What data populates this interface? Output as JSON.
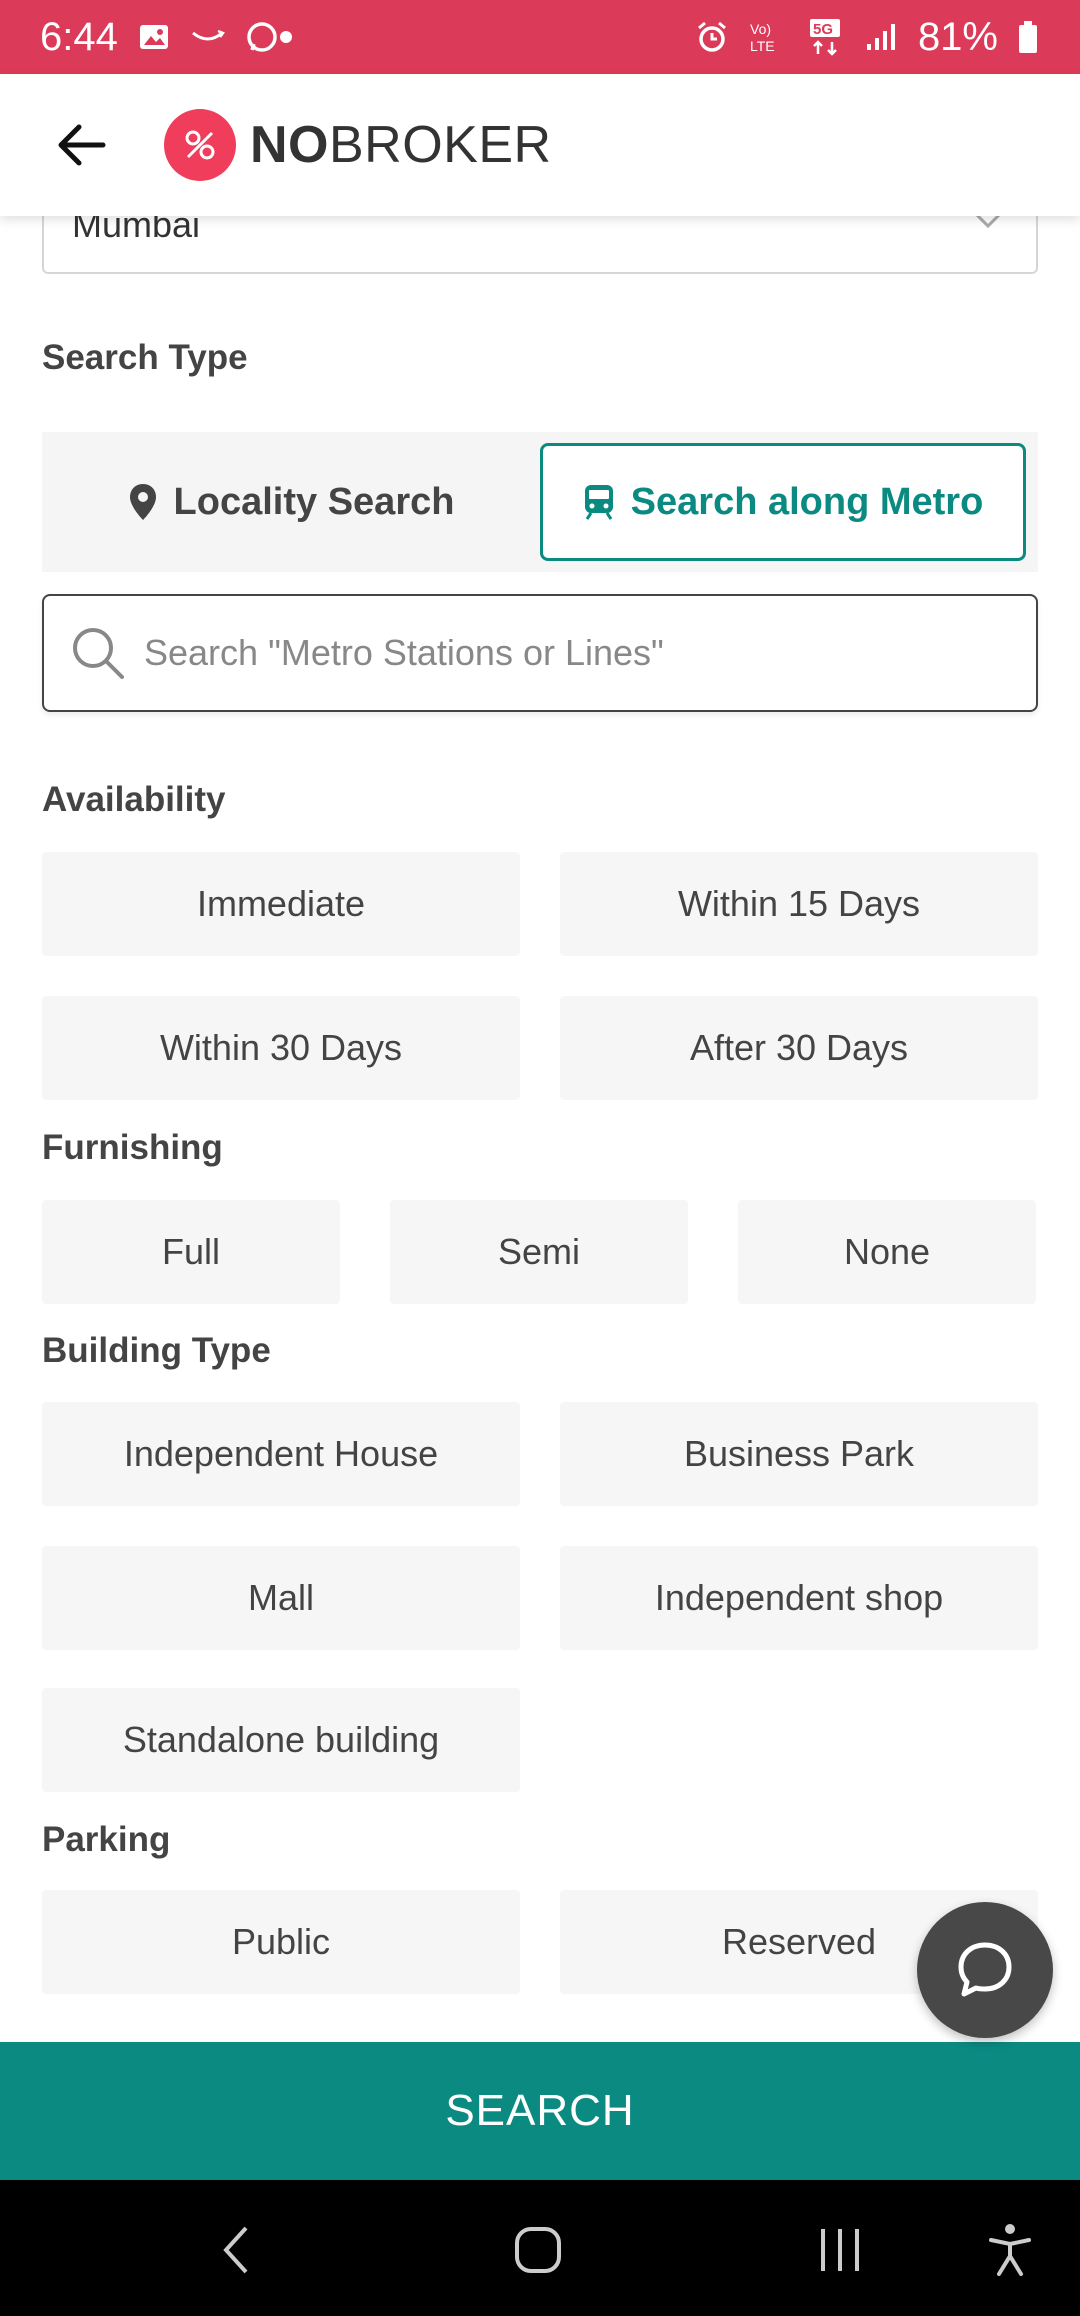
{
  "status_bar": {
    "time": "6:44",
    "network_label": "5G",
    "battery": "81%"
  },
  "header": {
    "logo_bold": "NO",
    "logo_regular": "BROKER"
  },
  "city": {
    "value": "Mumbai"
  },
  "search_type": {
    "label": "Search Type",
    "options": [
      "Locality Search",
      "Search along Metro"
    ],
    "selected": "Search along Metro"
  },
  "search": {
    "placeholder": "Search \"Metro Stations or Lines\""
  },
  "availability": {
    "label": "Availability",
    "options": [
      "Immediate",
      "Within 15 Days",
      "Within 30 Days",
      "After 30 Days"
    ]
  },
  "furnishing": {
    "label": "Furnishing",
    "options": [
      "Full",
      "Semi",
      "None"
    ]
  },
  "building_type": {
    "label": "Building Type",
    "options": [
      "Independent House",
      "Business Park",
      "Mall",
      "Independent shop",
      "Standalone building"
    ]
  },
  "parking": {
    "label": "Parking",
    "options": [
      "Public",
      "Reserved"
    ]
  },
  "search_button": {
    "label": "SEARCH"
  },
  "colors": {
    "status_bar": "#dc3a59",
    "accent": "#0b8a82",
    "brand": "#ef3d5b"
  },
  "icons": {
    "back": "arrow-left-icon",
    "locality": "location-pin-icon",
    "metro": "train-icon",
    "search": "search-icon",
    "chat": "chat-bubble-icon"
  }
}
